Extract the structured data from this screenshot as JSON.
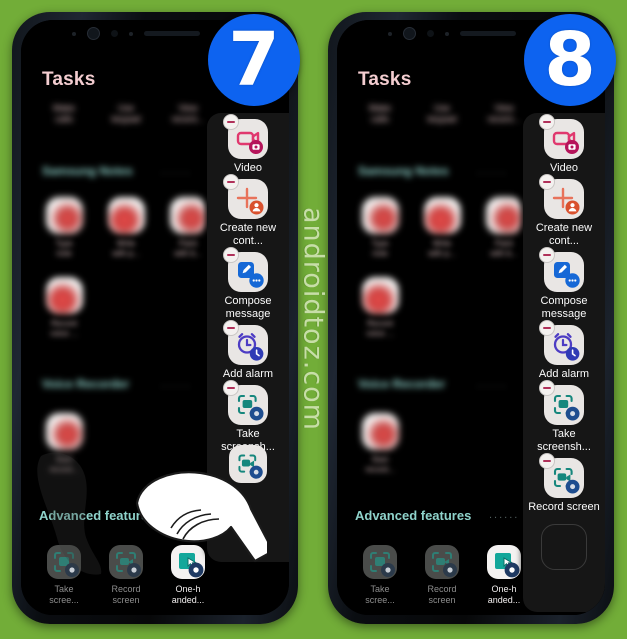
{
  "background_color": "#72ad38",
  "watermark": {
    "text": "androidtoz.com",
    "color": "#d6e7bb"
  },
  "badges": {
    "left": "7",
    "right": "8",
    "color": "#0d63f0"
  },
  "phones": [
    {
      "id": "left",
      "screen_title": "Tasks",
      "quick_rows": [
        {
          "line1": "Make",
          "line2": "calls"
        },
        {
          "line1": "Use",
          "line2": "keypad"
        },
        {
          "line1": "View",
          "line2": "recent..."
        }
      ],
      "sections": [
        {
          "heading": "Samsung Notes",
          "dots": "......"
        },
        {
          "heading": "Voice Recorder",
          "dots": "......"
        },
        {
          "heading": "Advanced features",
          "dots": "......"
        }
      ],
      "notes_apps": [
        {
          "line1": "Type",
          "line2": "note"
        },
        {
          "line1": "Write",
          "line2": "with p..."
        },
        {
          "line1": "Paint",
          "line2": "with b..."
        }
      ],
      "recorder_apps": [
        {
          "line1": "Start",
          "line2": "record..."
        }
      ],
      "advanced_apps": [
        {
          "line1": "Take",
          "line2": "scree...",
          "state": "dim"
        },
        {
          "line1": "Record",
          "line2": "screen",
          "state": "dim"
        },
        {
          "line1": "One-h",
          "line2": "anded...",
          "state": "bright"
        }
      ],
      "panel_items": [
        {
          "icon": "video-camera-icon",
          "label": "Video"
        },
        {
          "icon": "create-contact-icon",
          "label": "Create new cont..."
        },
        {
          "icon": "compose-message-icon",
          "label": "Compose message"
        },
        {
          "icon": "add-alarm-icon",
          "label": "Add alarm"
        },
        {
          "icon": "take-screenshot-icon",
          "label": "Take screensh..."
        }
      ],
      "empty_slot": false,
      "has_hand_cursor": true,
      "dragged_icon": "record-screen-icon"
    },
    {
      "id": "right",
      "screen_title": "Tasks",
      "quick_rows": [
        {
          "line1": "Make",
          "line2": "calls"
        },
        {
          "line1": "Use",
          "line2": "keypad"
        },
        {
          "line1": "View",
          "line2": "recent..."
        }
      ],
      "sections": [
        {
          "heading": "Samsung Notes",
          "dots": "......"
        },
        {
          "heading": "Voice Recorder",
          "dots": "......"
        },
        {
          "heading": "Advanced features",
          "dots": "......"
        }
      ],
      "notes_apps": [
        {
          "line1": "Type",
          "line2": "note"
        },
        {
          "line1": "Write",
          "line2": "with p..."
        },
        {
          "line1": "Paint",
          "line2": "with b..."
        }
      ],
      "recorder_apps": [
        {
          "line1": "Start",
          "line2": "record..."
        }
      ],
      "advanced_apps": [
        {
          "line1": "Take",
          "line2": "scree...",
          "state": "dim"
        },
        {
          "line1": "Record",
          "line2": "screen",
          "state": "dim"
        },
        {
          "line1": "One-h",
          "line2": "anded...",
          "state": "bright"
        }
      ],
      "panel_items": [
        {
          "icon": "video-camera-icon",
          "label": "Video"
        },
        {
          "icon": "create-contact-icon",
          "label": "Create new cont..."
        },
        {
          "icon": "compose-message-icon",
          "label": "Compose message"
        },
        {
          "icon": "add-alarm-icon",
          "label": "Add alarm"
        },
        {
          "icon": "take-screenshot-icon",
          "label": "Take screensh..."
        },
        {
          "icon": "record-screen-icon",
          "label": "Record screen"
        }
      ],
      "empty_slot": true,
      "has_hand_cursor": false
    }
  ]
}
